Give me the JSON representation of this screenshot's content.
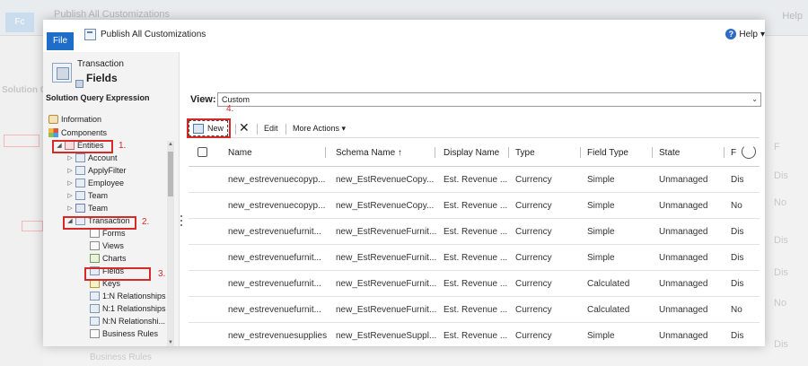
{
  "background": {
    "file_label": "Fc",
    "title": "Publish All Customizations",
    "help": "Help",
    "left_text": "Solution Q",
    "right_texts": [
      "F",
      "Dis",
      "No",
      "Dis",
      "Dis",
      "No",
      "Dis"
    ],
    "bottom_text": "Business Rules"
  },
  "toolbar": {
    "file_label": "File",
    "publish_label": "Publish All Customizations",
    "help_label": "Help",
    "help_glyph": "?",
    "help_caret": "▾"
  },
  "entity_header": {
    "title": "Transaction",
    "subtitle": "Fields"
  },
  "nav": {
    "section_title": "Solution Query Expression",
    "items": [
      {
        "label": "Information",
        "icon": "info-icon"
      },
      {
        "label": "Components",
        "icon": "components-icon"
      },
      {
        "label": "Entities",
        "icon": "entities-icon",
        "twisty": "◢"
      },
      {
        "label": "Account",
        "icon": "entity-icon",
        "twisty": "▷"
      },
      {
        "label": "ApplyFilter",
        "icon": "entity-icon",
        "twisty": "▷"
      },
      {
        "label": "Employee",
        "icon": "entity-icon",
        "twisty": "▷"
      },
      {
        "label": "Team",
        "icon": "entity-icon",
        "twisty": "▷"
      },
      {
        "label": "Team",
        "icon": "team-icon",
        "twisty": "▷"
      },
      {
        "label": "Transaction",
        "icon": "entity-icon",
        "twisty": "◢"
      },
      {
        "label": "Forms",
        "icon": "form-icon"
      },
      {
        "label": "Views",
        "icon": "view-icon"
      },
      {
        "label": "Charts",
        "icon": "chart-icon"
      },
      {
        "label": "Fields",
        "icon": "field-icon"
      },
      {
        "label": "Keys",
        "icon": "key-icon"
      },
      {
        "label": "1:N Relationships",
        "icon": "relationship-icon"
      },
      {
        "label": "N:1 Relationships",
        "icon": "relationship-icon"
      },
      {
        "label": "N:N Relationshi...",
        "icon": "relationship-icon"
      },
      {
        "label": "Business Rules",
        "icon": "business-rule-icon"
      }
    ]
  },
  "annotations": [
    "1.",
    "2.",
    "3.",
    "4."
  ],
  "view": {
    "label": "View:",
    "selected": "Custom",
    "arrow": "⌄"
  },
  "commands": {
    "new_label": "New",
    "delete_glyph": "✕",
    "edit_label": "Edit",
    "more_label": "More Actions",
    "more_caret": "▾"
  },
  "grid": {
    "columns": [
      "Name",
      "Schema Name ↑",
      "Display Name",
      "Type",
      "Field Type",
      "State",
      "F"
    ],
    "rows": [
      [
        "new_estrevenuecopyp...",
        "new_EstRevenueCopy...",
        "Est. Revenue ...",
        "Currency",
        "Simple",
        "Unmanaged",
        "Dis"
      ],
      [
        "new_estrevenuecopyp...",
        "new_EstRevenueCopy...",
        "Est. Revenue ...",
        "Currency",
        "Simple",
        "Unmanaged",
        "No"
      ],
      [
        "new_estrevenuefurnit...",
        "new_EstRevenueFurnit...",
        "Est. Revenue ...",
        "Currency",
        "Simple",
        "Unmanaged",
        "Dis"
      ],
      [
        "new_estrevenuefurnit...",
        "new_EstRevenueFurnit...",
        "Est. Revenue ...",
        "Currency",
        "Simple",
        "Unmanaged",
        "Dis"
      ],
      [
        "new_estrevenuefurnit...",
        "new_EstRevenueFurnit...",
        "Est. Revenue ...",
        "Currency",
        "Calculated",
        "Unmanaged",
        "Dis"
      ],
      [
        "new_estrevenuefurnit...",
        "new_EstRevenueFurnit...",
        "Est. Revenue ...",
        "Currency",
        "Calculated",
        "Unmanaged",
        "No"
      ],
      [
        "new_estrevenuesupplies",
        "new_EstRevenueSuppl...",
        "Est. Revenue ...",
        "Currency",
        "Simple",
        "Unmanaged",
        "Dis"
      ]
    ]
  },
  "scroll": {
    "up": "▲",
    "down": "▼"
  },
  "colors": {
    "accent": "#1f6dc8",
    "annotation": "#d82929"
  }
}
